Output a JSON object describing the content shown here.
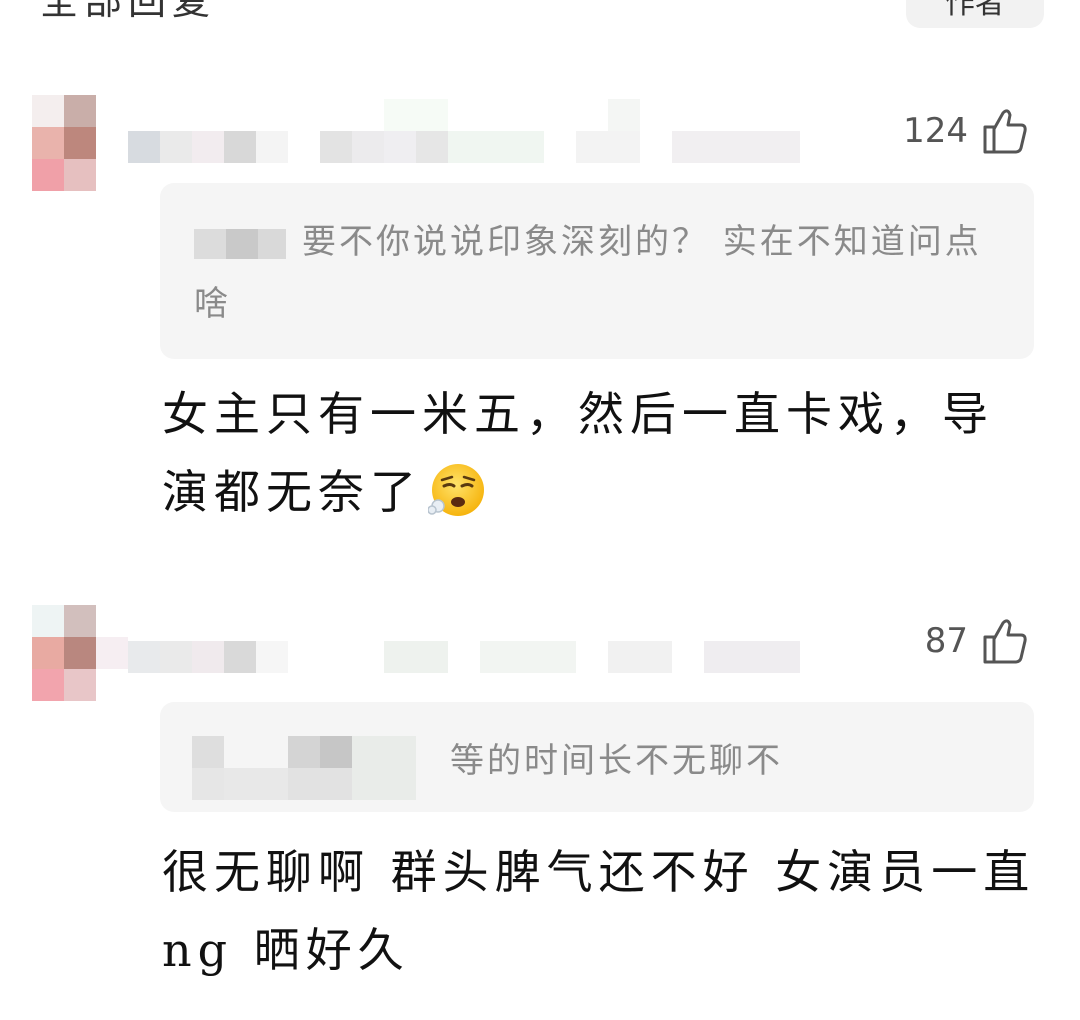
{
  "header": {
    "cut_text": "全部回复",
    "author_badge": "作者"
  },
  "comments": [
    {
      "likes": "124",
      "quote": "要不你说说印象深刻的？ 实在不知道问点啥",
      "body": "女主只有一米五，然后一直卡戏，导演都无奈了",
      "emoji": "face-exhaling-icon"
    },
    {
      "likes": "87",
      "quote": "等的时间长不无聊不",
      "body": "很无聊啊 群头脾气还不好 女演员一直ng 晒好久",
      "emoji": ""
    }
  ],
  "colors": {
    "quote_bg": "#f5f5f5",
    "quote_text": "#8a8a8a",
    "likes_text": "#555555",
    "body_text": "#111111"
  }
}
